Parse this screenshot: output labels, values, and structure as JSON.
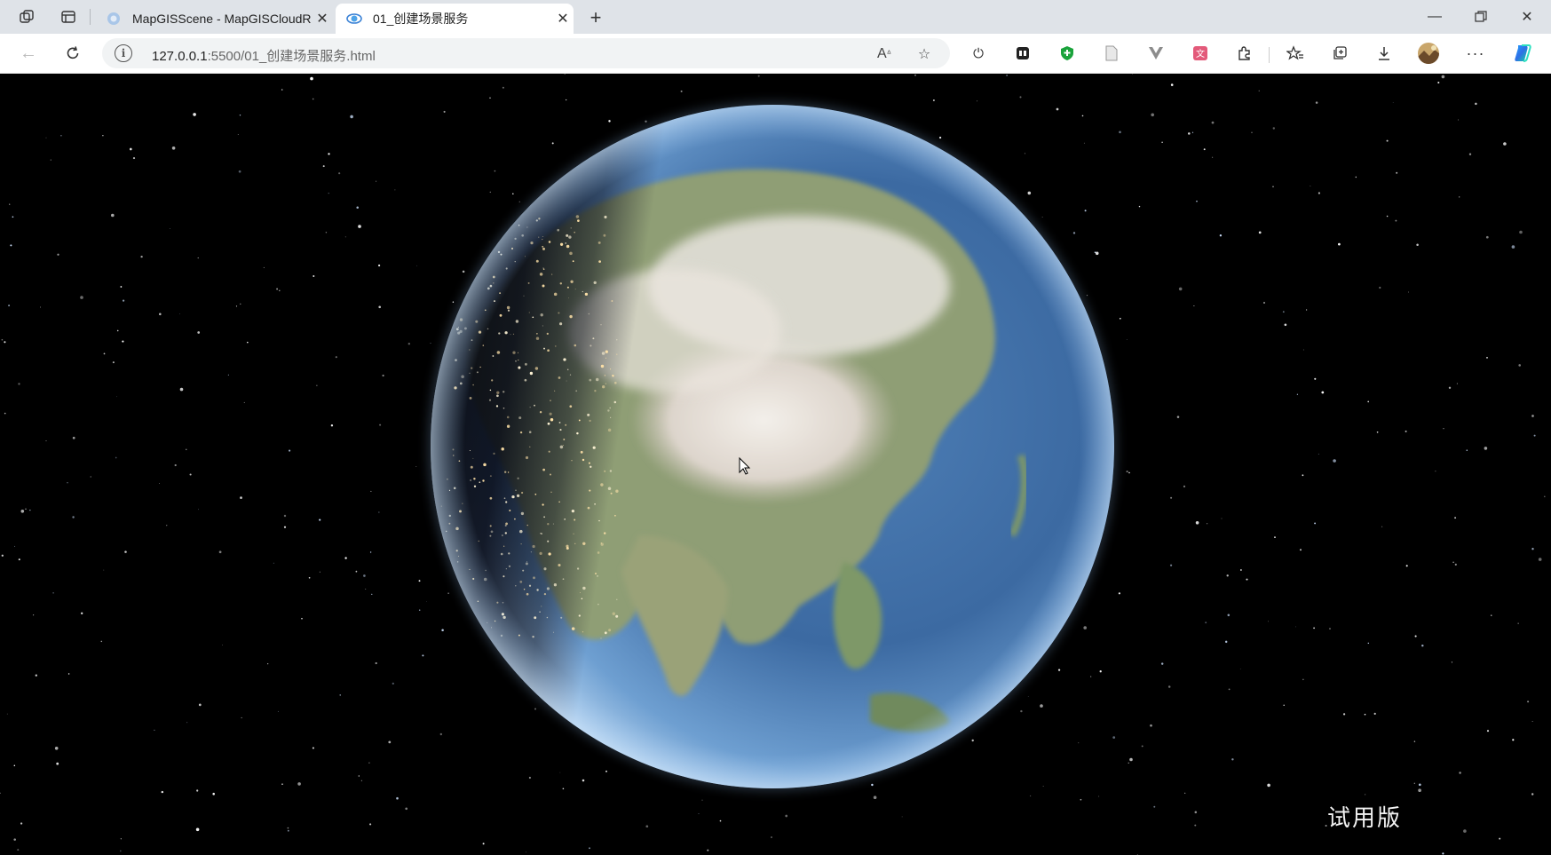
{
  "browser": {
    "tabs": [
      {
        "title": "MapGISScene - MapGISCloudRe",
        "active": false
      },
      {
        "title": "01_创建场景服务",
        "active": true
      }
    ],
    "url_host": "127.0.0.1",
    "url_rest": ":5500/01_创建场景服务.html",
    "extensions": [
      "power-icon",
      "copilot-square-icon",
      "shield-icon",
      "document-icon",
      "vue-icon",
      "translate-icon",
      "puzzle-icon",
      "favorites-icon",
      "collections-icon",
      "download-icon",
      "profile-avatar",
      "more-icon",
      "copilot-icon"
    ]
  },
  "scene": {
    "watermark": "试用版",
    "background": "#000000"
  }
}
